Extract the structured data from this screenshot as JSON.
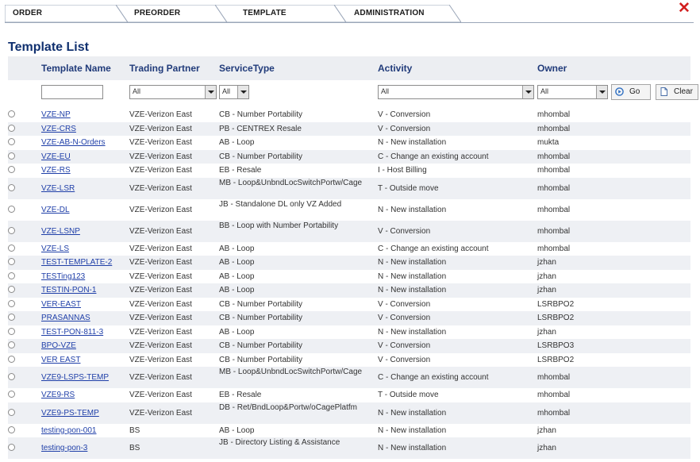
{
  "tabs": [
    "ORDER",
    "PREORDER",
    "TEMPLATE",
    "ADMINISTRATION"
  ],
  "page_title": "Template List",
  "columns": [
    "Template Name",
    "Trading Partner",
    "ServiceType",
    "Activity",
    "Owner"
  ],
  "filters": {
    "template_name": "",
    "trading_partner": "All",
    "service_type": "All",
    "activity": "All",
    "owner": "All",
    "go_label": "Go",
    "clear_label": "Clear"
  },
  "rows": [
    [
      "VZE-NP",
      "VZE-Verizon East",
      "CB - Number Portability",
      "V - Conversion",
      "mhombal"
    ],
    [
      "VZE-CRS",
      "VZE-Verizon East",
      "PB - CENTREX Resale",
      "V - Conversion",
      "mhombal"
    ],
    [
      "VZE-AB-N-Orders",
      "VZE-Verizon East",
      "AB - Loop",
      "N - New installation",
      "mukta"
    ],
    [
      "VZE-EU",
      "VZE-Verizon East",
      "CB - Number Portability",
      "C - Change an existing account",
      "mhombal"
    ],
    [
      "VZE-RS",
      "VZE-Verizon East",
      "EB - Resale",
      "I - Host Billing",
      "mhombal"
    ],
    [
      "VZE-LSR",
      "VZE-Verizon East",
      "MB - Loop&UnbndLocSwitchPortw/Cage",
      "T - Outside move",
      "mhombal"
    ],
    [
      "VZE-DL",
      "VZE-Verizon East",
      "JB - Standalone DL only VZ Added",
      "N - New installation",
      "mhombal"
    ],
    [
      "VZE-LSNP",
      "VZE-Verizon East",
      "BB - Loop with Number Portability",
      "V - Conversion",
      "mhombal"
    ],
    [
      "VZE-LS",
      "VZE-Verizon East",
      "AB - Loop",
      "C - Change an existing account",
      "mhombal"
    ],
    [
      "TEST-TEMPLATE-2",
      "VZE-Verizon East",
      "AB - Loop",
      "N - New installation",
      "jzhan"
    ],
    [
      "TESTing123",
      "VZE-Verizon East",
      "AB - Loop",
      "N - New installation",
      "jzhan"
    ],
    [
      "TESTIN-PON-1",
      "VZE-Verizon East",
      "AB - Loop",
      "N - New installation",
      "jzhan"
    ],
    [
      "VER-EAST",
      "VZE-Verizon East",
      "CB - Number Portability",
      "V - Conversion",
      "LSRBPO2"
    ],
    [
      "PRASANNAS",
      "VZE-Verizon East",
      "CB - Number Portability",
      "V - Conversion",
      "LSRBPO2"
    ],
    [
      "TEST-PON-811-3",
      "VZE-Verizon East",
      "AB - Loop",
      "N - New installation",
      "jzhan"
    ],
    [
      "BPO-VZE",
      "VZE-Verizon East",
      "CB - Number Portability",
      "V - Conversion",
      "LSRBPO3"
    ],
    [
      "VER EAST",
      "VZE-Verizon East",
      "CB - Number Portability",
      "V - Conversion",
      "LSRBPO2"
    ],
    [
      "VZE9-LSPS-TEMP",
      "VZE-Verizon East",
      "MB - Loop&UnbndLocSwitchPortw/Cage",
      "C - Change an existing account",
      "mhombal"
    ],
    [
      "VZE9-RS",
      "VZE-Verizon East",
      "EB - Resale",
      "T - Outside move",
      "mhombal"
    ],
    [
      "VZE9-PS-TEMP",
      "VZE-Verizon East",
      "DB - Ret/BndLoop&Portw/oCagePlatfm",
      "N - New installation",
      "mhombal"
    ],
    [
      "testing-pon-001",
      "BS",
      "AB - Loop",
      "N - New installation",
      "jzhan"
    ],
    [
      "testing-pon-3",
      "BS",
      "JB - Directory Listing & Assistance",
      "N - New installation",
      "jzhan"
    ]
  ],
  "colors": {
    "title": "#10306f",
    "link": "#1f3fa8",
    "close": "#d21f1f",
    "stripe": "#eef0f4"
  }
}
